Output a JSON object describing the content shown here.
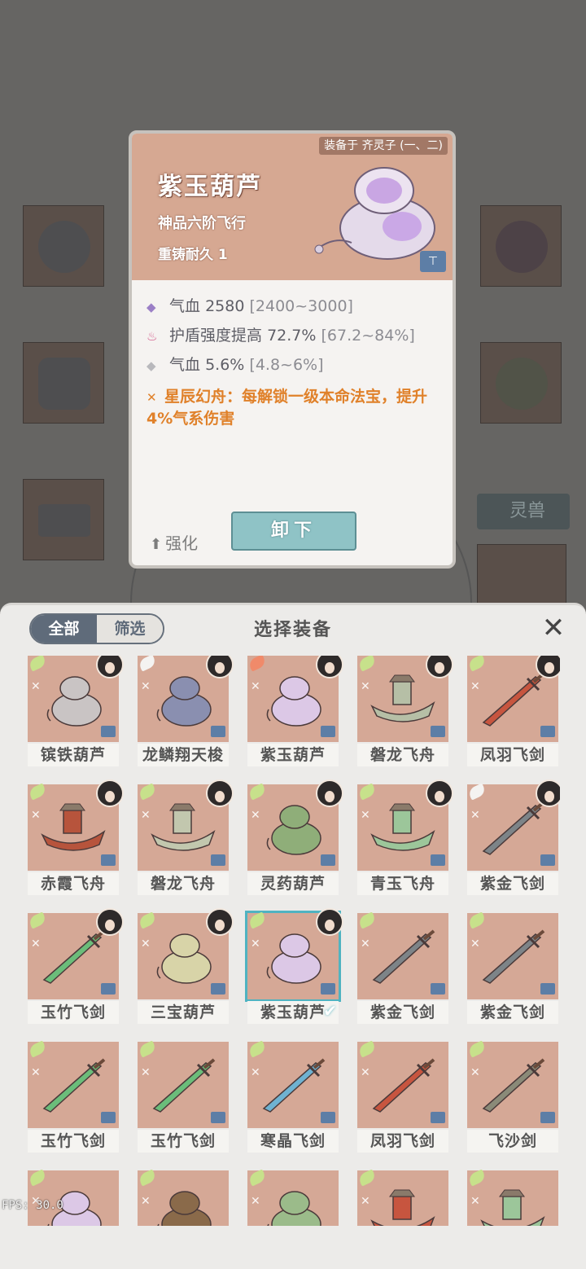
{
  "detail": {
    "equipped_to": "装备于 齐灵子 (一、二)",
    "name": "紫玉葫芦",
    "grade": "神品六阶飞行",
    "durability": "重铸耐久 1",
    "stats": [
      {
        "icon": "purple-diamond-icon",
        "label": "气血 2580",
        "range": "[2400~3000]"
      },
      {
        "icon": "flame-icon",
        "label": "护盾强度提高 72.7%",
        "range": "[67.2~84%]"
      },
      {
        "icon": "grey-diamond-icon",
        "label": "气血 5.6%",
        "range": "[4.8~6%]"
      }
    ],
    "special": "星辰幻舟：每解锁一级本命法宝，提升4%气系伤害",
    "enhance_label": "强化",
    "unequip_label": "卸下"
  },
  "background": {
    "tab_label": "灵兽"
  },
  "panel": {
    "filter_all": "全部",
    "filter_sift": "筛选",
    "title": "选择装备"
  },
  "items": [
    {
      "name": "镔铁葫芦",
      "feather": "green",
      "avatar": true,
      "art": "gourd",
      "color": "#c9c4c4"
    },
    {
      "name": "龙鳞翔天梭",
      "feather": "white",
      "avatar": true,
      "art": "shuttle",
      "color": "#8a8fb0"
    },
    {
      "name": "紫玉葫芦",
      "feather": "red",
      "avatar": true,
      "art": "gourd",
      "color": "#dcc8e6"
    },
    {
      "name": "磐龙飞舟",
      "feather": "green",
      "avatar": true,
      "art": "boat",
      "color": "#b6bfa6"
    },
    {
      "name": "凤羽飞剑",
      "feather": "green",
      "avatar": true,
      "art": "sword",
      "color": "#c7553f"
    },
    {
      "name": "赤霞飞舟",
      "feather": "green",
      "avatar": true,
      "art": "boat",
      "color": "#b7543c"
    },
    {
      "name": "磐龙飞舟",
      "feather": "green",
      "avatar": true,
      "art": "boat",
      "color": "#c2c7ae"
    },
    {
      "name": "灵药葫芦",
      "feather": "green",
      "avatar": true,
      "art": "gourd",
      "color": "#8fae79"
    },
    {
      "name": "青玉飞舟",
      "feather": "green",
      "avatar": true,
      "art": "boat",
      "color": "#9cc69a"
    },
    {
      "name": "紫金飞剑",
      "feather": "white",
      "avatar": true,
      "art": "sword",
      "color": "#7d8488"
    },
    {
      "name": "玉竹飞剑",
      "feather": "green",
      "avatar": true,
      "art": "sword",
      "color": "#6bbd7a"
    },
    {
      "name": "三宝葫芦",
      "feather": "green",
      "avatar": true,
      "art": "gourd",
      "color": "#d8d4a8"
    },
    {
      "name": "紫玉葫芦",
      "feather": "green",
      "avatar": true,
      "art": "gourd",
      "color": "#dcc8e6",
      "selected": true
    },
    {
      "name": "紫金飞剑",
      "feather": "green",
      "avatar": false,
      "art": "sword",
      "color": "#7d8488"
    },
    {
      "name": "紫金飞剑",
      "feather": "green",
      "avatar": false,
      "art": "sword",
      "color": "#7d8488"
    },
    {
      "name": "玉竹飞剑",
      "feather": "green",
      "avatar": false,
      "art": "sword",
      "color": "#6bbd7a"
    },
    {
      "name": "玉竹飞剑",
      "feather": "green",
      "avatar": false,
      "art": "sword",
      "color": "#6bbd7a"
    },
    {
      "name": "寒晶飞剑",
      "feather": "green",
      "avatar": false,
      "art": "sword",
      "color": "#6fb2d1"
    },
    {
      "name": "凤羽飞剑",
      "feather": "green",
      "avatar": false,
      "art": "sword",
      "color": "#c7553f"
    },
    {
      "name": "飞沙剑",
      "feather": "green",
      "avatar": false,
      "art": "sword",
      "color": "#8a8a78"
    },
    {
      "name": "",
      "feather": "green",
      "avatar": false,
      "art": "gourd",
      "color": "#dcc8e6"
    },
    {
      "name": "",
      "feather": "green",
      "avatar": false,
      "art": "gourd",
      "color": "#8a6a4a"
    },
    {
      "name": "",
      "feather": "green",
      "avatar": false,
      "art": "gourd",
      "color": "#9bbb8a"
    },
    {
      "name": "",
      "feather": "green",
      "avatar": false,
      "art": "boat",
      "color": "#c7553f"
    },
    {
      "name": "",
      "feather": "green",
      "avatar": false,
      "art": "boat",
      "color": "#9cc69a"
    }
  ],
  "fps": "FPS: 30.0",
  "colors": {
    "accent": "#4fb3c1",
    "special_text": "#e0812a",
    "card_bg": "#d5a896"
  }
}
